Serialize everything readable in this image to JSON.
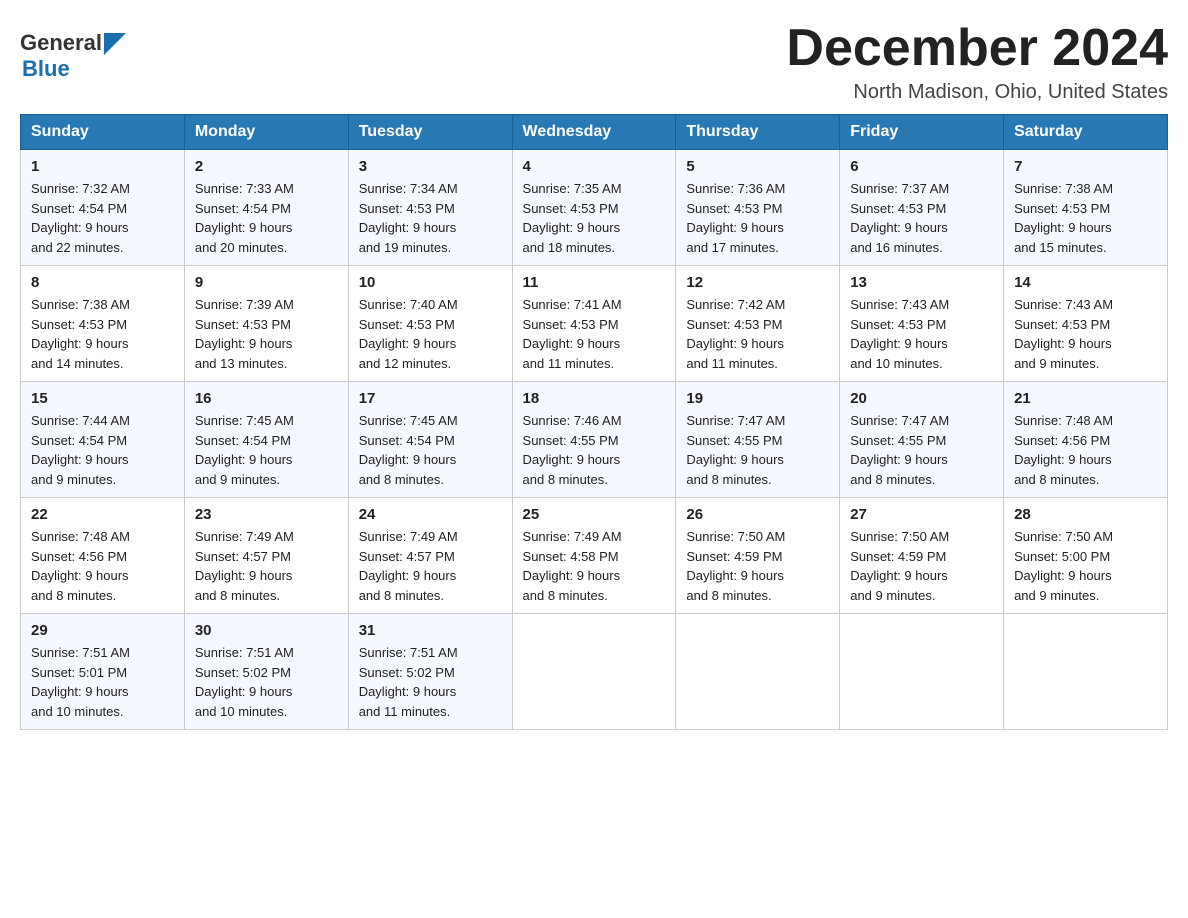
{
  "header": {
    "logo_text_general": "General",
    "logo_text_blue": "Blue",
    "month_title": "December 2024",
    "location": "North Madison, Ohio, United States"
  },
  "columns": [
    "Sunday",
    "Monday",
    "Tuesday",
    "Wednesday",
    "Thursday",
    "Friday",
    "Saturday"
  ],
  "weeks": [
    {
      "days": [
        {
          "num": "1",
          "sunrise": "7:32 AM",
          "sunset": "4:54 PM",
          "daylight": "9 hours and 22 minutes."
        },
        {
          "num": "2",
          "sunrise": "7:33 AM",
          "sunset": "4:54 PM",
          "daylight": "9 hours and 20 minutes."
        },
        {
          "num": "3",
          "sunrise": "7:34 AM",
          "sunset": "4:53 PM",
          "daylight": "9 hours and 19 minutes."
        },
        {
          "num": "4",
          "sunrise": "7:35 AM",
          "sunset": "4:53 PM",
          "daylight": "9 hours and 18 minutes."
        },
        {
          "num": "5",
          "sunrise": "7:36 AM",
          "sunset": "4:53 PM",
          "daylight": "9 hours and 17 minutes."
        },
        {
          "num": "6",
          "sunrise": "7:37 AM",
          "sunset": "4:53 PM",
          "daylight": "9 hours and 16 minutes."
        },
        {
          "num": "7",
          "sunrise": "7:38 AM",
          "sunset": "4:53 PM",
          "daylight": "9 hours and 15 minutes."
        }
      ]
    },
    {
      "days": [
        {
          "num": "8",
          "sunrise": "7:38 AM",
          "sunset": "4:53 PM",
          "daylight": "9 hours and 14 minutes."
        },
        {
          "num": "9",
          "sunrise": "7:39 AM",
          "sunset": "4:53 PM",
          "daylight": "9 hours and 13 minutes."
        },
        {
          "num": "10",
          "sunrise": "7:40 AM",
          "sunset": "4:53 PM",
          "daylight": "9 hours and 12 minutes."
        },
        {
          "num": "11",
          "sunrise": "7:41 AM",
          "sunset": "4:53 PM",
          "daylight": "9 hours and 11 minutes."
        },
        {
          "num": "12",
          "sunrise": "7:42 AM",
          "sunset": "4:53 PM",
          "daylight": "9 hours and 11 minutes."
        },
        {
          "num": "13",
          "sunrise": "7:43 AM",
          "sunset": "4:53 PM",
          "daylight": "9 hours and 10 minutes."
        },
        {
          "num": "14",
          "sunrise": "7:43 AM",
          "sunset": "4:53 PM",
          "daylight": "9 hours and 9 minutes."
        }
      ]
    },
    {
      "days": [
        {
          "num": "15",
          "sunrise": "7:44 AM",
          "sunset": "4:54 PM",
          "daylight": "9 hours and 9 minutes."
        },
        {
          "num": "16",
          "sunrise": "7:45 AM",
          "sunset": "4:54 PM",
          "daylight": "9 hours and 9 minutes."
        },
        {
          "num": "17",
          "sunrise": "7:45 AM",
          "sunset": "4:54 PM",
          "daylight": "9 hours and 8 minutes."
        },
        {
          "num": "18",
          "sunrise": "7:46 AM",
          "sunset": "4:55 PM",
          "daylight": "9 hours and 8 minutes."
        },
        {
          "num": "19",
          "sunrise": "7:47 AM",
          "sunset": "4:55 PM",
          "daylight": "9 hours and 8 minutes."
        },
        {
          "num": "20",
          "sunrise": "7:47 AM",
          "sunset": "4:55 PM",
          "daylight": "9 hours and 8 minutes."
        },
        {
          "num": "21",
          "sunrise": "7:48 AM",
          "sunset": "4:56 PM",
          "daylight": "9 hours and 8 minutes."
        }
      ]
    },
    {
      "days": [
        {
          "num": "22",
          "sunrise": "7:48 AM",
          "sunset": "4:56 PM",
          "daylight": "9 hours and 8 minutes."
        },
        {
          "num": "23",
          "sunrise": "7:49 AM",
          "sunset": "4:57 PM",
          "daylight": "9 hours and 8 minutes."
        },
        {
          "num": "24",
          "sunrise": "7:49 AM",
          "sunset": "4:57 PM",
          "daylight": "9 hours and 8 minutes."
        },
        {
          "num": "25",
          "sunrise": "7:49 AM",
          "sunset": "4:58 PM",
          "daylight": "9 hours and 8 minutes."
        },
        {
          "num": "26",
          "sunrise": "7:50 AM",
          "sunset": "4:59 PM",
          "daylight": "9 hours and 8 minutes."
        },
        {
          "num": "27",
          "sunrise": "7:50 AM",
          "sunset": "4:59 PM",
          "daylight": "9 hours and 9 minutes."
        },
        {
          "num": "28",
          "sunrise": "7:50 AM",
          "sunset": "5:00 PM",
          "daylight": "9 hours and 9 minutes."
        }
      ]
    },
    {
      "days": [
        {
          "num": "29",
          "sunrise": "7:51 AM",
          "sunset": "5:01 PM",
          "daylight": "9 hours and 10 minutes."
        },
        {
          "num": "30",
          "sunrise": "7:51 AM",
          "sunset": "5:02 PM",
          "daylight": "9 hours and 10 minutes."
        },
        {
          "num": "31",
          "sunrise": "7:51 AM",
          "sunset": "5:02 PM",
          "daylight": "9 hours and 11 minutes."
        },
        null,
        null,
        null,
        null
      ]
    }
  ],
  "labels": {
    "sunrise": "Sunrise:",
    "sunset": "Sunset:",
    "daylight": "Daylight:"
  }
}
